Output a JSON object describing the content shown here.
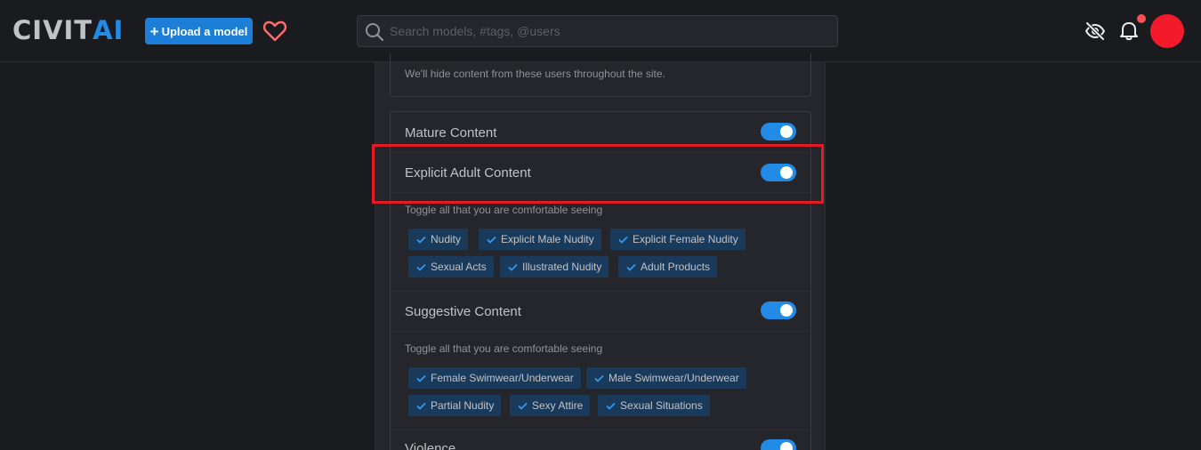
{
  "header": {
    "logo_civ": "CIVIT",
    "logo_ai": "AI",
    "upload_plus": "+",
    "upload_label": "Upload a model",
    "search_placeholder": "Search models, #tags, @users",
    "colors": {
      "brand": "#228be6",
      "avatar": "#f31a2c",
      "notification_dot": "#fa5252",
      "heart": "#ff6b6b"
    },
    "icons": [
      "heart-icon",
      "search-icon",
      "eye-off-icon",
      "bell-icon"
    ]
  },
  "hidden_users": {
    "description": "We'll hide content from these users throughout the site."
  },
  "mature": {
    "label": "Mature Content",
    "enabled": true
  },
  "explicit": {
    "label": "Explicit Adult Content",
    "enabled": true,
    "sublabel": "Toggle all that you are comfortable seeing",
    "tags": [
      "Nudity",
      "Explicit Male Nudity",
      "Explicit Female Nudity",
      "Sexual Acts",
      "Illustrated Nudity",
      "Adult Products"
    ]
  },
  "suggestive": {
    "label": "Suggestive Content",
    "enabled": true,
    "sublabel": "Toggle all that you are comfortable seeing",
    "tags": [
      "Female Swimwear/Underwear",
      "Male Swimwear/Underwear",
      "Partial Nudity",
      "Sexy Attire",
      "Sexual Situations"
    ]
  },
  "violence": {
    "label": "Violence",
    "enabled": true
  },
  "colors": {
    "toggle_on": "#228be6",
    "chip_bg": "#1a3a5c",
    "highlight": "#e41b23"
  }
}
